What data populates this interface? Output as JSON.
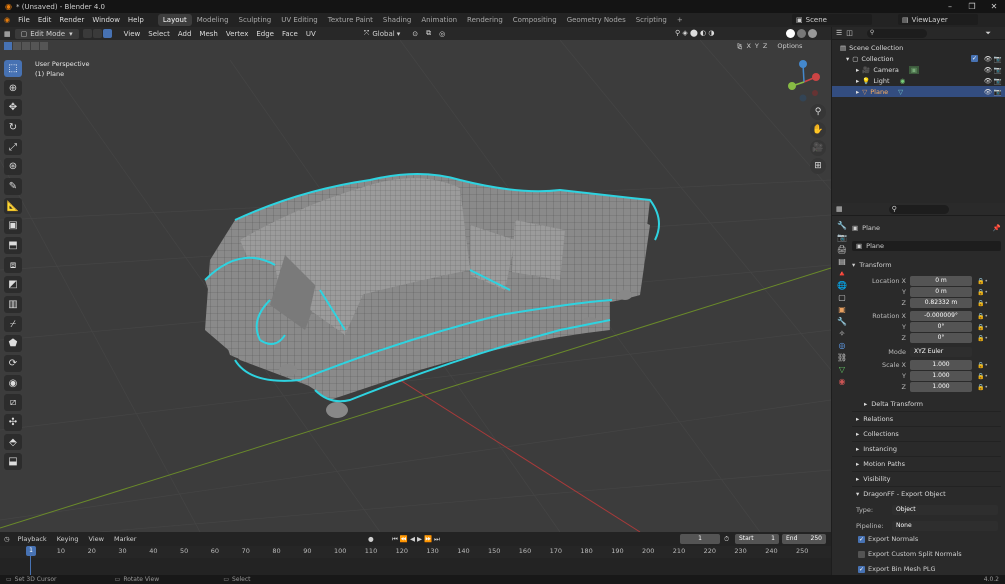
{
  "window": {
    "title": "* (Unsaved) - Blender 4.0"
  },
  "menu": {
    "items": [
      "File",
      "Edit",
      "Render",
      "Window",
      "Help"
    ],
    "workspaces": [
      "Layout",
      "Modeling",
      "Sculpting",
      "UV Editing",
      "Texture Paint",
      "Shading",
      "Animation",
      "Rendering",
      "Compositing",
      "Geometry Nodes",
      "Scripting"
    ],
    "active_workspace": "Layout",
    "scene": "Scene",
    "view_layer": "ViewLayer"
  },
  "viewport_header": {
    "mode": "Edit Mode",
    "menus": [
      "View",
      "Select",
      "Add",
      "Mesh",
      "Vertex",
      "Edge",
      "Face",
      "UV"
    ],
    "transform_orientation": "Global",
    "options_label": "Options",
    "axes": [
      "X",
      "Y",
      "Z"
    ]
  },
  "viewport": {
    "view_name": "User Perspective",
    "object_name": "(1) Plane"
  },
  "timeline": {
    "menus": [
      "Playback",
      "Keying",
      "View",
      "Marker"
    ],
    "current_frame": "1",
    "start_label": "Start",
    "start": "1",
    "end_label": "End",
    "end": "250",
    "ticks": [
      "1",
      "10",
      "20",
      "30",
      "40",
      "50",
      "60",
      "70",
      "80",
      "90",
      "100",
      "110",
      "120",
      "130",
      "140",
      "150",
      "160",
      "170",
      "180",
      "190",
      "200",
      "210",
      "220",
      "230",
      "240",
      "250"
    ]
  },
  "status": {
    "left": "Set 3D Cursor",
    "middle": "Rotate View",
    "right": "Select",
    "version": "4.0.2"
  },
  "outliner": {
    "scene_collection": "Scene Collection",
    "collection": "Collection",
    "objects": [
      "Camera",
      "Light",
      "Plane"
    ],
    "selected": "Plane"
  },
  "properties": {
    "object_name": "Plane",
    "data_name": "Plane",
    "transform_title": "Transform",
    "location": {
      "label": "Location X",
      "x": "0 m",
      "y": "0 m",
      "z": "0.82332 m"
    },
    "rotation": {
      "label": "Rotation X",
      "x": "-0.000009°",
      "y": "0°",
      "z": "0°"
    },
    "mode_label": "Mode",
    "mode_value": "XYZ Euler",
    "scale": {
      "label": "Scale X",
      "x": "1.000",
      "y": "1.000",
      "z": "1.000"
    },
    "axis_y": "Y",
    "axis_z": "Z",
    "sections": [
      "Delta Transform",
      "Relations",
      "Collections",
      "Instancing",
      "Motion Paths",
      "Visibility"
    ],
    "export_section": "DragonFF - Export Object",
    "type_label": "Type:",
    "type_value": "Object",
    "pipeline_label": "Pipeline:",
    "pipeline_value": "None",
    "checks": [
      {
        "label": "Export Normals",
        "checked": true
      },
      {
        "label": "Export Custom Split Normals",
        "checked": false
      },
      {
        "label": "Export Bin Mesh PLG",
        "checked": true
      }
    ]
  },
  "colors": {
    "accent": "#4772b3",
    "selection": "#2ed3e0",
    "mesh": "#9a9a9a"
  }
}
